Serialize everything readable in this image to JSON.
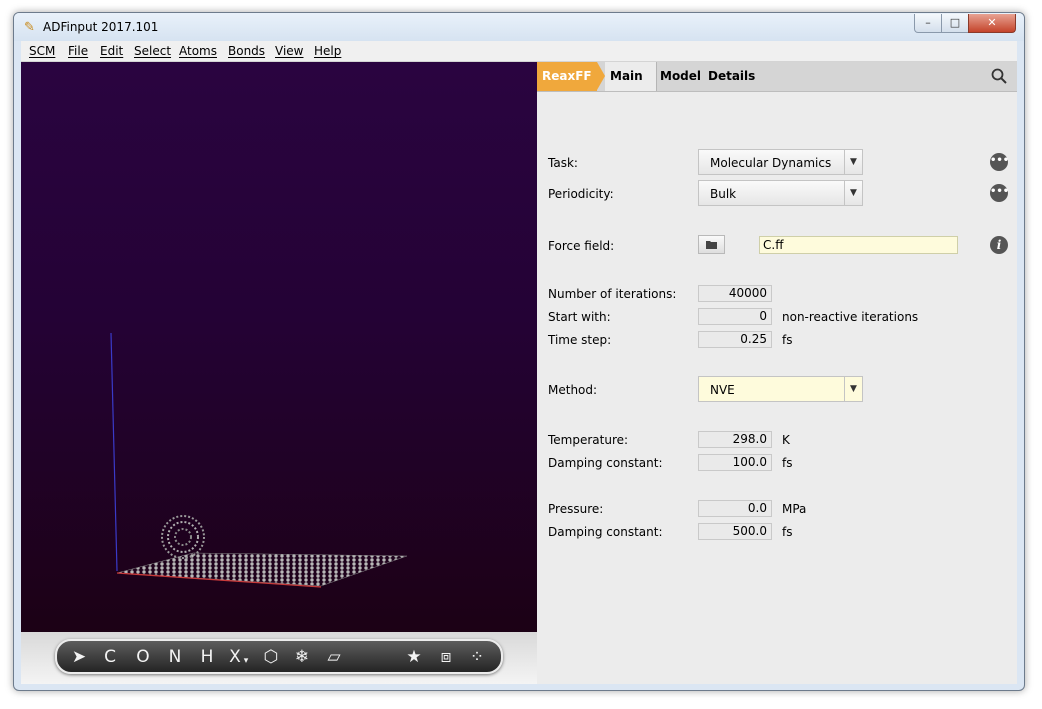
{
  "window": {
    "title": "ADFinput 2017.101",
    "app_icon": "wand-icon",
    "controls": {
      "minimize": "–",
      "maximize": "□",
      "close": "✕"
    }
  },
  "menubar": {
    "items": [
      {
        "label": "SCM"
      },
      {
        "label": "File"
      },
      {
        "label": "Edit"
      },
      {
        "label": "Select"
      },
      {
        "label": "Atoms"
      },
      {
        "label": "Bonds"
      },
      {
        "label": "View"
      },
      {
        "label": "Help"
      }
    ]
  },
  "viewport": {
    "background": "#240235",
    "scene": "carbon-fullerene-on-graphene-slab"
  },
  "atom_toolbar": {
    "tools": [
      {
        "icon": "select-arrow-icon",
        "glyph": "➤"
      },
      {
        "label": "C"
      },
      {
        "label": "O"
      },
      {
        "label": "N"
      },
      {
        "label": "H"
      },
      {
        "label": "X",
        "suffix": "▾"
      },
      {
        "icon": "hexagon-icon",
        "glyph": "⬡"
      },
      {
        "icon": "snowflake-icon",
        "glyph": "❄"
      },
      {
        "icon": "plane-icon",
        "glyph": "▱"
      },
      {
        "icon": "star-icon",
        "glyph": "★"
      },
      {
        "icon": "cell-icon",
        "glyph": "⧈"
      },
      {
        "icon": "molecules-icon",
        "glyph": "⁘"
      }
    ]
  },
  "tabs": {
    "engine": "ReaxFF",
    "main": "Main",
    "model": "Model",
    "details": "Details",
    "accent": "#f0a83c"
  },
  "form": {
    "task": {
      "label": "Task:",
      "value": "Molecular Dynamics"
    },
    "periodicity": {
      "label": "Periodicity:",
      "value": "Bulk"
    },
    "force_field": {
      "label": "Force field:",
      "value": "C.ff"
    },
    "iterations": {
      "label": "Number of iterations:",
      "value": "40000"
    },
    "start_with": {
      "label": "Start with:",
      "value": "0",
      "unit": "non-reactive iterations"
    },
    "time_step": {
      "label": "Time step:",
      "value": "0.25",
      "unit": "fs"
    },
    "method": {
      "label": "Method:",
      "value": "NVE"
    },
    "temperature": {
      "label": "Temperature:",
      "value": "298.0",
      "unit": "K"
    },
    "temp_damping": {
      "label": "Damping constant:",
      "value": "100.0",
      "unit": "fs"
    },
    "pressure": {
      "label": "Pressure:",
      "value": "0.0",
      "unit": "MPa"
    },
    "pressure_damping": {
      "label": "Damping constant:",
      "value": "500.0",
      "unit": "fs"
    },
    "more_glyph": "•••",
    "info_glyph": "i"
  }
}
